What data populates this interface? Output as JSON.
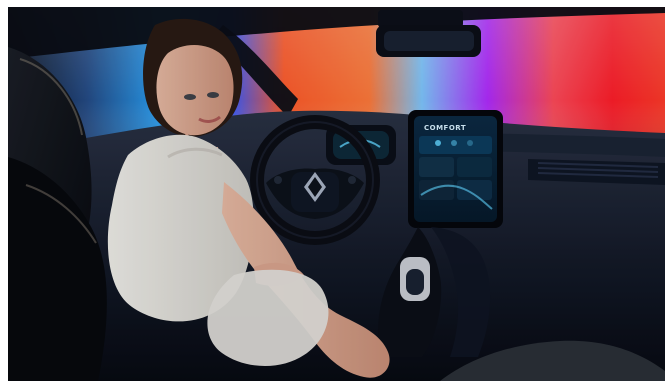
{
  "photo": {
    "subject": "woman-in-driver-seat",
    "backdrop_colors": [
      "#2aa7ff",
      "#ff5a2a",
      "#b12bff",
      "#ff1e2a"
    ],
    "infotainment_screen": {
      "header_text": "COMFORT",
      "accent_color": "#61d4ff"
    },
    "steering_wheel_logo": "diamond-logo"
  }
}
